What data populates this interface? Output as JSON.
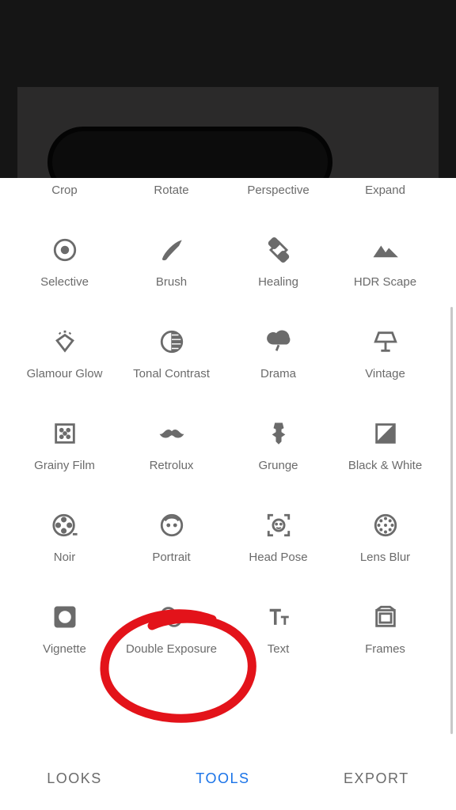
{
  "tools_row0": [
    {
      "label": "Crop"
    },
    {
      "label": "Rotate"
    },
    {
      "label": "Perspective"
    },
    {
      "label": "Expand"
    }
  ],
  "tools": [
    {
      "label": "Selective",
      "icon": "target-icon"
    },
    {
      "label": "Brush",
      "icon": "brush-icon"
    },
    {
      "label": "Healing",
      "icon": "bandage-icon"
    },
    {
      "label": "HDR Scape",
      "icon": "mountains-icon"
    },
    {
      "label": "Glamour Glow",
      "icon": "diamond-sparkle-icon"
    },
    {
      "label": "Tonal Contrast",
      "icon": "half-circle-icon"
    },
    {
      "label": "Drama",
      "icon": "cloud-bolt-icon"
    },
    {
      "label": "Vintage",
      "icon": "lamp-icon"
    },
    {
      "label": "Grainy Film",
      "icon": "film-dots-icon"
    },
    {
      "label": "Retrolux",
      "icon": "mustache-icon"
    },
    {
      "label": "Grunge",
      "icon": "guitar-icon"
    },
    {
      "label": "Black & White",
      "icon": "bw-square-icon"
    },
    {
      "label": "Noir",
      "icon": "film-reel-icon"
    },
    {
      "label": "Portrait",
      "icon": "face-icon"
    },
    {
      "label": "Head Pose",
      "icon": "face-detect-icon"
    },
    {
      "label": "Lens Blur",
      "icon": "dotted-circle-icon"
    },
    {
      "label": "Vignette",
      "icon": "vignette-icon"
    },
    {
      "label": "Double Exposure",
      "icon": "overlap-circles-icon"
    },
    {
      "label": "Text",
      "icon": "text-icon"
    },
    {
      "label": "Frames",
      "icon": "frame-icon"
    }
  ],
  "tabs": {
    "looks": "LOOKS",
    "tools": "TOOLS",
    "export": "EXPORT"
  },
  "annotation": {
    "circled_tool": "Double Exposure",
    "color": "#e3131a"
  }
}
